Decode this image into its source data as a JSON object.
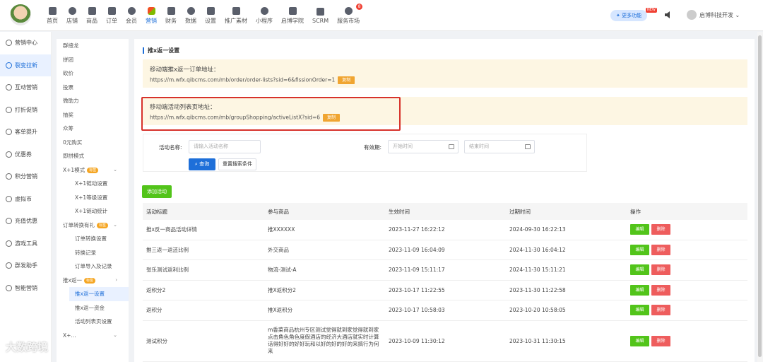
{
  "nav": {
    "items": [
      "首页",
      "店铺",
      "商品",
      "订单",
      "会员",
      "营销",
      "财务",
      "数据",
      "设置",
      "推广素材",
      "小程序",
      "启博学院",
      "SCRM",
      "服务市场"
    ],
    "active_index": 5,
    "badge_count": "8"
  },
  "header": {
    "more_features": "更多功能",
    "new_tag": "NEW",
    "user_name": "启博科技开发"
  },
  "sidebar1": {
    "items": [
      "营销中心",
      "裂变拉新",
      "互动营销",
      "打折促销",
      "客单提升",
      "优惠券",
      "积分营销",
      "虚拟币",
      "充值优惠",
      "游戏工具",
      "群发助手",
      "智能营销"
    ],
    "active_index": 1
  },
  "sidebar2": {
    "items": [
      "群接龙",
      "拼团",
      "砍价",
      "投票",
      "微助力",
      "抽奖",
      "众筹",
      "0元购买",
      "即拼模式"
    ],
    "x1_mode": "X+1模式",
    "x1_subs": [
      "X+1链动设置",
      "X+1等级设置",
      "X+1链动统计"
    ],
    "order_gift": "订单转换有礼",
    "order_subs": [
      "订单转换设置",
      "转换记录",
      "订单导入及记录"
    ],
    "push_return": "推x返一",
    "push_subs": [
      "推x返一设置",
      "推x返一资金",
      "活动列表页设置"
    ],
    "tag_label": "标签",
    "more": "X+..."
  },
  "page": {
    "title": "推x返一设置",
    "order_addr_label": "移动端推x返一订单地址：",
    "order_addr_url": "https://m.wfx.qibcms.com/mb/order/order-lists?sid=6&fissionOrder=1",
    "list_addr_label": "移动端活动列表页地址：",
    "list_addr_url": "https://m.wfx.qibcms.com/mb/groupShopping/activeListX?sid=6",
    "copy_label": "复制"
  },
  "search": {
    "name_label": "活动名称:",
    "name_placeholder": "请输入活动名称",
    "validity_label": "有效期:",
    "start_placeholder": "开始时间",
    "end_placeholder": "结束时间",
    "query_label": "查询",
    "reset_label": "重置搜索条件"
  },
  "add_label": "添加活动",
  "table": {
    "headers": [
      "活动标题",
      "参与商品",
      "生效时间",
      "过期时间",
      "操作"
    ],
    "rows": [
      {
        "title": "推x反一商品活动详情",
        "goods": "推XXXXXX",
        "start": "2023-11-27 16:22:12",
        "end": "2024-09-30 16:22:13"
      },
      {
        "title": "推三返一返还比例",
        "goods": "外交商品",
        "start": "2023-11-09 16:04:09",
        "end": "2024-11-30 16:04:12"
      },
      {
        "title": "张乐测试返利比例",
        "goods": "物流-测试-A",
        "start": "2023-11-09 15:11:17",
        "end": "2024-11-30 15:11:21"
      },
      {
        "title": "返积分2",
        "goods": "推X返积分2",
        "start": "2023-10-17 11:22:55",
        "end": "2023-11-30 11:22:58"
      },
      {
        "title": "返积分",
        "goods": "推X返积分",
        "start": "2023-10-17 10:58:03",
        "end": "2023-10-20 10:58:05"
      },
      {
        "title": "测试积分",
        "goods": "m香菜商品杭州专区测试觉得就到家觉得就到家点击角色角色度假酒店的经济大酒店就实时计算话得好好的好好玩和以好的好的好的来搞行为何来",
        "start": "2023-10-09 11:30:12",
        "end": "2023-10-31 11:30:15"
      }
    ],
    "edit_label": "编辑",
    "delete_label": "删除"
  },
  "watermark": "大数跨境"
}
